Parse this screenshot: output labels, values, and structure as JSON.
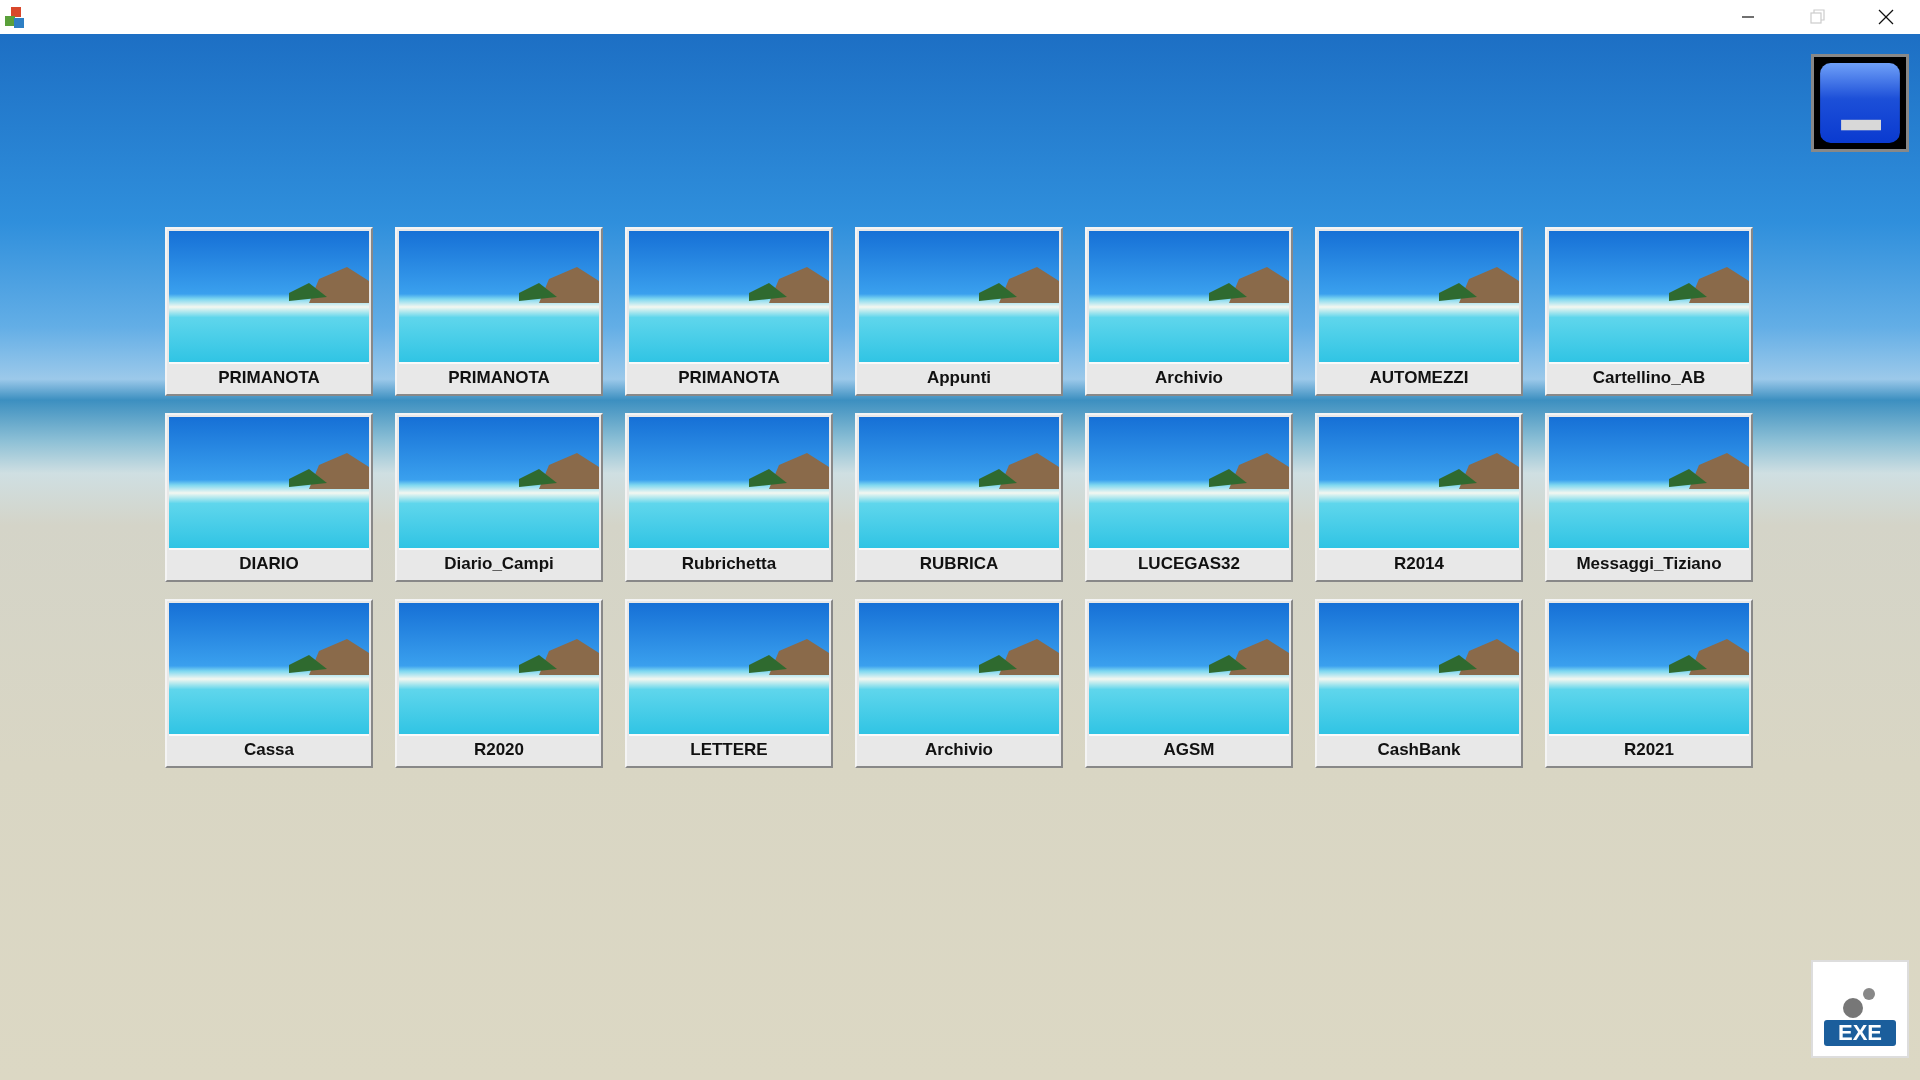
{
  "window": {
    "controls": [
      {
        "kind": "minimize",
        "disabled": false
      },
      {
        "kind": "restore",
        "disabled": true
      },
      {
        "kind": "close",
        "disabled": false
      }
    ]
  },
  "tiles": [
    {
      "label": "PRIMANOTA"
    },
    {
      "label": "PRIMANOTA"
    },
    {
      "label": "PRIMANOTA"
    },
    {
      "label": "Appunti"
    },
    {
      "label": "Archivio"
    },
    {
      "label": "AUTOMEZZI"
    },
    {
      "label": "Cartellino_AB"
    },
    {
      "label": "DIARIO"
    },
    {
      "label": "Diario_Campi"
    },
    {
      "label": "Rubrichetta"
    },
    {
      "label": "RUBRICA"
    },
    {
      "label": "LUCEGAS32"
    },
    {
      "label": "R2014"
    },
    {
      "label": "Messaggi_Tiziano"
    },
    {
      "label": "Cassa"
    },
    {
      "label": "R2020"
    },
    {
      "label": "LETTERE"
    },
    {
      "label": "Archivio"
    },
    {
      "label": "AGSM"
    },
    {
      "label": "CashBank"
    },
    {
      "label": "R2021"
    }
  ],
  "exe_button": {
    "label": "EXE"
  }
}
